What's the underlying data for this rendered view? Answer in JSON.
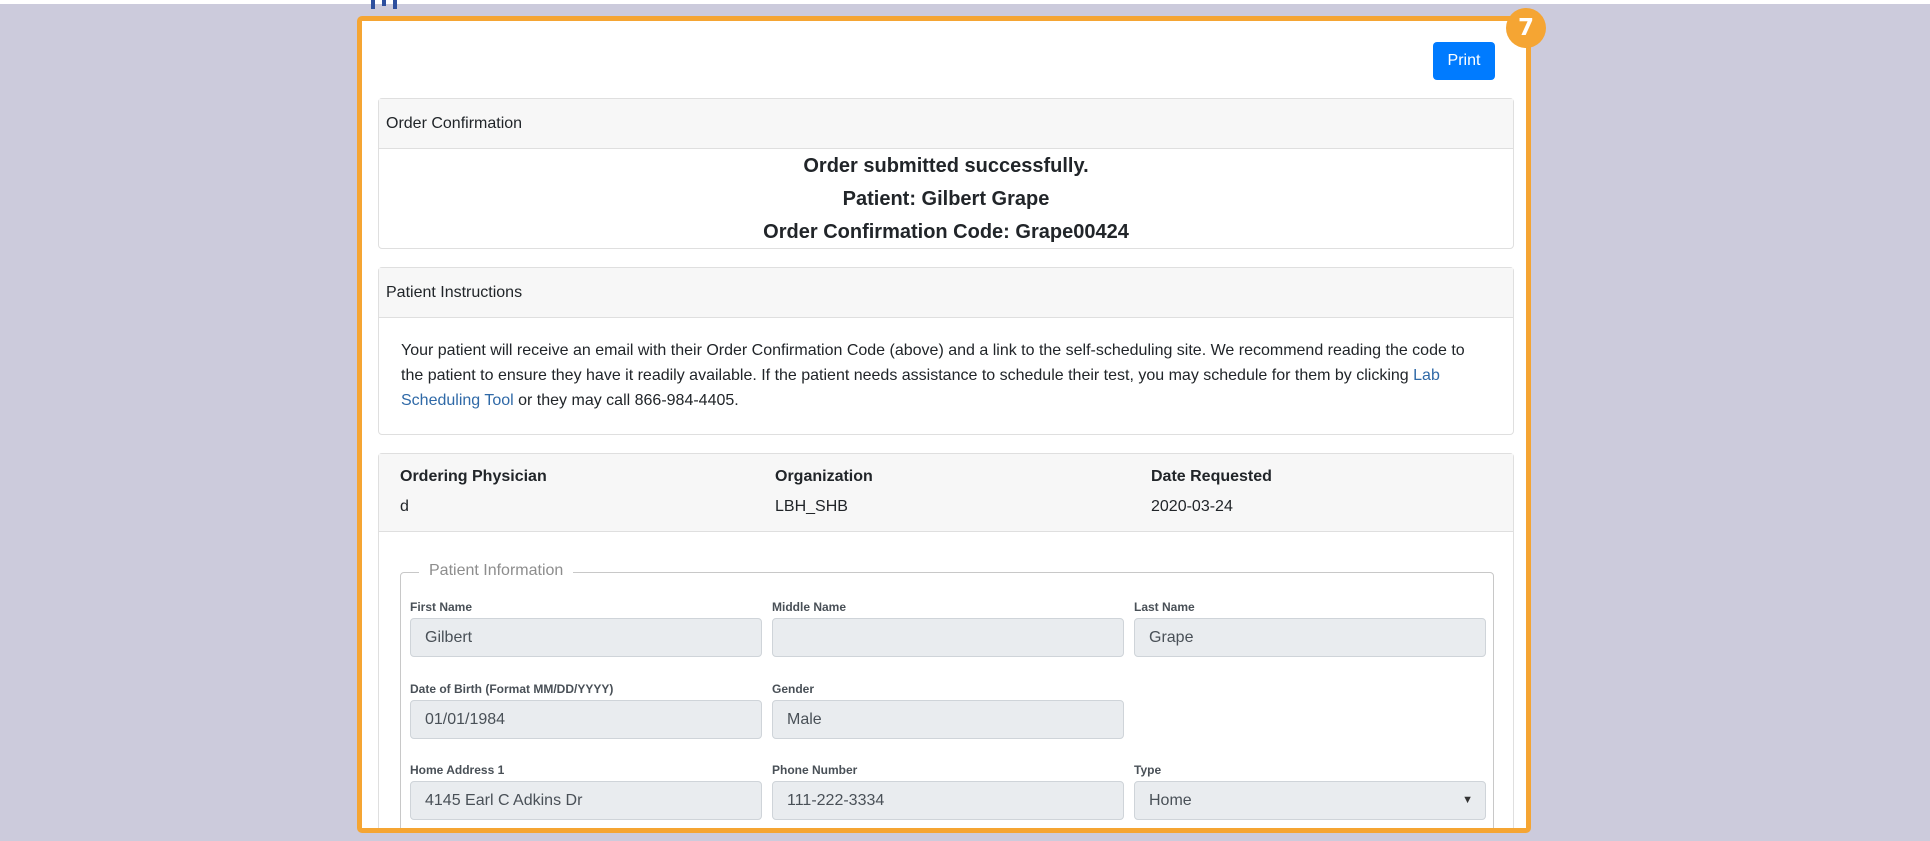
{
  "badge": "7",
  "toolbar": {
    "print_label": "Print"
  },
  "confirmation": {
    "header": "Order Confirmation",
    "line1": "Order submitted successfully.",
    "line2": "Patient: Gilbert Grape",
    "line3": "Order Confirmation Code: Grape00424"
  },
  "instructions": {
    "header": "Patient Instructions",
    "text_before_link": "Your patient will receive an email with their Order Confirmation Code (above) and a link to the self-scheduling site. We recommend reading the code to the patient to ensure they have it readily available. If the patient needs assistance to schedule their test, you may schedule for them by clicking ",
    "link_text": "Lab Scheduling Tool",
    "text_after_link": " or they may call 866-984-4405."
  },
  "order_info": {
    "physician_label": "Ordering Physician",
    "physician_value": "d",
    "organization_label": "Organization",
    "organization_value": "LBH_SHB",
    "date_label": "Date Requested",
    "date_value": "2020-03-24"
  },
  "patient": {
    "legend": "Patient Information",
    "first_name_label": "First Name",
    "first_name": "Gilbert",
    "middle_name_label": "Middle Name",
    "middle_name": "",
    "last_name_label": "Last Name",
    "last_name": "Grape",
    "dob_label": "Date of Birth (Format MM/DD/YYYY)",
    "dob": "01/01/1984",
    "gender_label": "Gender",
    "gender": "Male",
    "address_label": "Home Address 1",
    "address": "4145 Earl C Adkins Dr",
    "phone_label": "Phone Number",
    "phone": "111-222-3334",
    "type_label": "Type",
    "type": "Home"
  },
  "colors": {
    "accent": "#f5a533",
    "primary": "#007bff",
    "link": "#2f69a7"
  }
}
